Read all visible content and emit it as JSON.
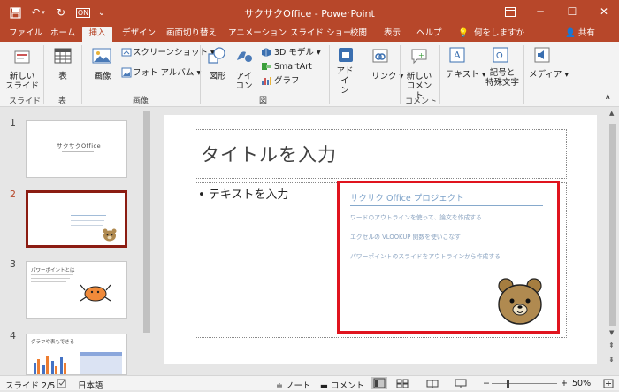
{
  "window": {
    "title": "サクサクOffice  -  PowerPoint",
    "quick_access": {
      "autosave_label": "ON"
    }
  },
  "tabs": [
    "ファイル",
    "ホーム",
    "挿入",
    "デザイン",
    "画面切り替え",
    "アニメーション",
    "スライド ショー",
    "校閲",
    "表示",
    "ヘルプ",
    "何をしますか"
  ],
  "share_label": "共有",
  "ribbon": {
    "new_slide": "新しい\nスライド",
    "table": "表",
    "image": "画像",
    "screenshot": "スクリーンショット",
    "photo_album": "フォト アルバム",
    "shapes": "図形",
    "icons": "アイ\nコン",
    "model_3d": "3D モデル",
    "smartart": "SmartArt",
    "graph": "グラフ",
    "addin": "アドイ\nン",
    "link": "リンク",
    "new_comment": "新しい\nコメント",
    "text": "テキスト",
    "symbols": "記号と\n特殊文字",
    "media": "メディア",
    "groups": {
      "slides": "スライド",
      "table": "表",
      "images": "画像",
      "illustrations": "図",
      "comments": "コメント"
    }
  },
  "thumbnails": [
    {
      "num": "1",
      "title": "サクサクOffice"
    },
    {
      "num": "2",
      "title": ""
    },
    {
      "num": "3",
      "title": "パワーポイントとは"
    },
    {
      "num": "4",
      "title": "グラフや表もできる"
    }
  ],
  "slide": {
    "title_placeholder": "タイトルを入力",
    "body_placeholder": "• テキストを入力",
    "project_title": "サクサク Office プロジェクト",
    "items": [
      "ワードのアウトラインを使って、論文を作成する",
      "エクセルの VLOOKUP 関数を使いこなす",
      "パワーポイントのスライドをアウトラインから作成する"
    ]
  },
  "status": {
    "slide_info": "スライド 2/5",
    "language": "日本語",
    "notes": "ノート",
    "comments": "コメント",
    "zoom": "50%"
  },
  "colors": {
    "brand": "#b7472a",
    "selected_border": "#8b1c12",
    "highlight_red": "#e0141e"
  }
}
